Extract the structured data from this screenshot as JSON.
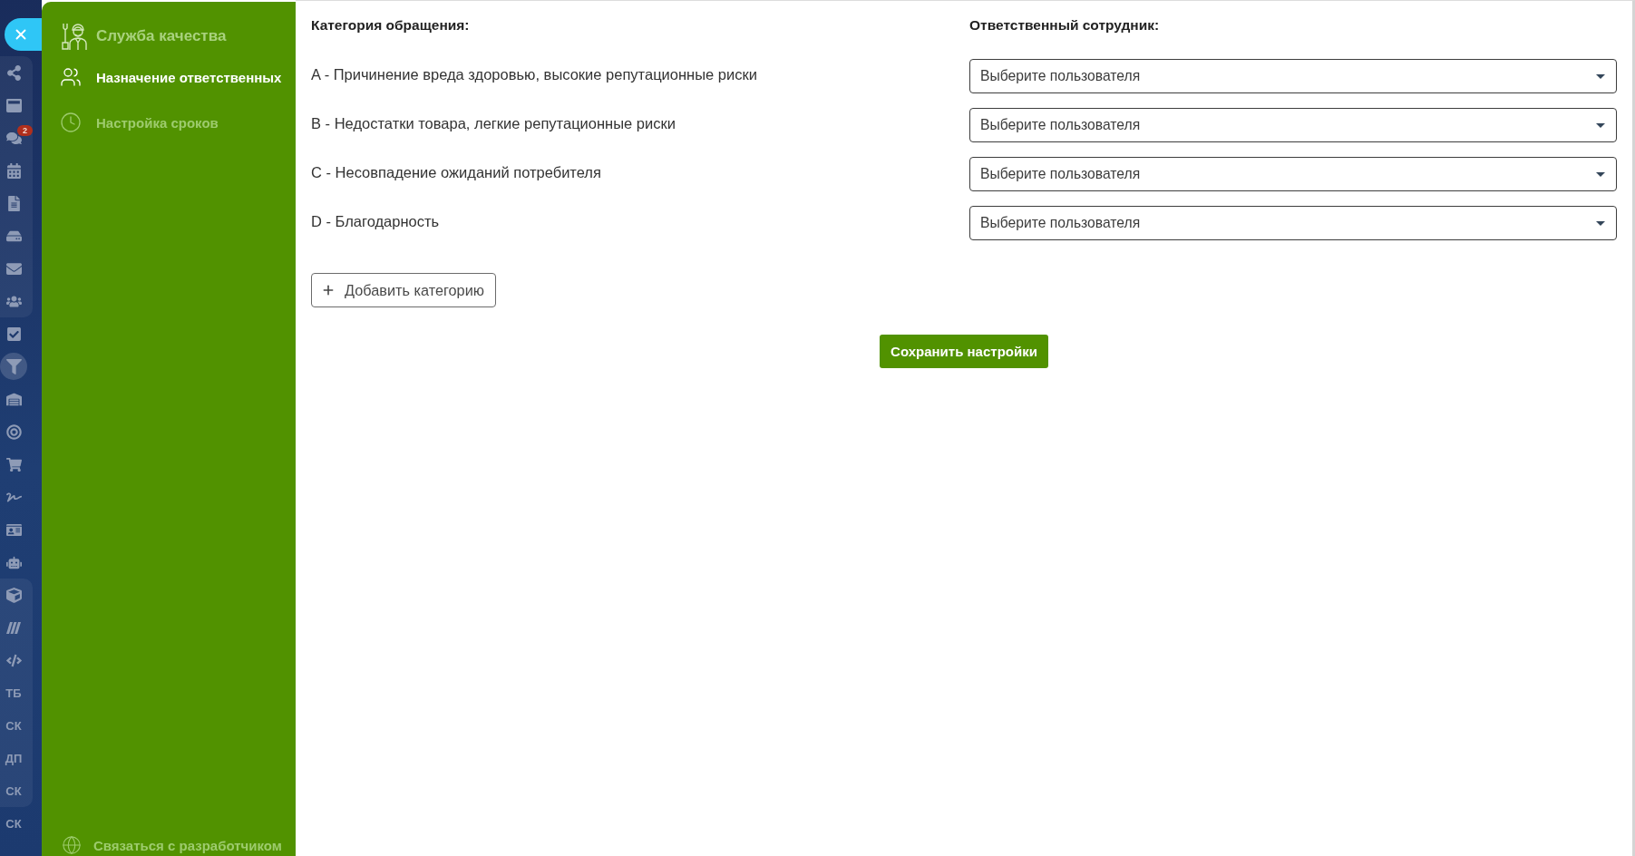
{
  "nav_rail": {
    "sections": [
      {
        "grouped": true,
        "items": [
          {
            "kind": "icon",
            "selected": false
          },
          {
            "kind": "icon",
            "selected": false
          },
          {
            "kind": "icon",
            "selected": false,
            "badge": "2"
          },
          {
            "kind": "icon",
            "selected": false
          },
          {
            "kind": "icon",
            "selected": false
          },
          {
            "kind": "icon",
            "selected": false
          },
          {
            "kind": "icon",
            "selected": false
          },
          {
            "kind": "icon",
            "selected": false
          }
        ]
      },
      {
        "grouped": false,
        "items": [
          {
            "kind": "icon",
            "selected": false
          },
          {
            "kind": "icon",
            "selected": true
          },
          {
            "kind": "icon",
            "selected": false
          },
          {
            "kind": "icon",
            "selected": false
          },
          {
            "kind": "icon",
            "selected": false
          },
          {
            "kind": "icon",
            "selected": false
          },
          {
            "kind": "icon",
            "selected": false
          },
          {
            "kind": "icon",
            "selected": false
          }
        ]
      },
      {
        "grouped": true,
        "items": [
          {
            "kind": "icon",
            "selected": false
          },
          {
            "kind": "icon",
            "selected": false
          },
          {
            "kind": "icon",
            "selected": false
          },
          {
            "kind": "text",
            "label": "ТБ",
            "selected": false
          },
          {
            "kind": "text",
            "label": "СК",
            "selected": false
          },
          {
            "kind": "text",
            "label": "ДП",
            "selected": false
          },
          {
            "kind": "text",
            "label": "СК",
            "selected": false
          }
        ]
      },
      {
        "grouped": false,
        "items": [
          {
            "kind": "text",
            "label": "СК",
            "selected": false
          }
        ]
      }
    ]
  },
  "sidebar": {
    "title": "Служба качества",
    "items": [
      {
        "label": "Назначение ответственных",
        "selected": true
      },
      {
        "label": "Настройка сроков",
        "selected": false
      }
    ],
    "footer_link": "Связаться с разработчиком"
  },
  "main": {
    "category_header": "Категория обращения:",
    "employee_header": "Ответственный сотрудник:",
    "rows": [
      {
        "category": "A - Причинение вреда здоровью, высокие репутационные риски",
        "employee_select": {
          "placeholder": "Выберите пользователя"
        }
      },
      {
        "category": "B - Недостатки товара, легкие репутационные риски",
        "employee_select": {
          "placeholder": "Выберите пользователя"
        }
      },
      {
        "category": "C - Несовпадение ожиданий потребителя",
        "employee_select": {
          "placeholder": "Выберите пользователя"
        }
      },
      {
        "category": "D - Благодарность",
        "employee_select": {
          "placeholder": "Выберите пользователя"
        }
      }
    ],
    "add_button": "Добавить категорию",
    "save_button": "Сохранить настройки"
  }
}
